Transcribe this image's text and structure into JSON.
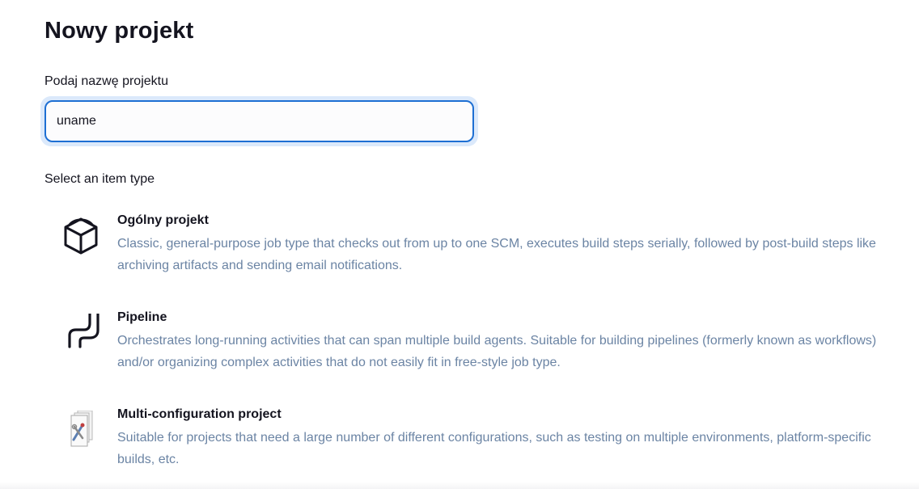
{
  "page": {
    "title": "Nowy projekt",
    "name_label": "Podaj nazwę projektu",
    "name_value": "uname",
    "section_label": "Select an item type"
  },
  "item_types": [
    {
      "name": "Ogólny projekt",
      "description": "Classic, general-purpose job type that checks out from up to one SCM, executes build steps serially, followed by post-build steps like archiving artifacts and sending email notifications.",
      "icon": "cube-icon"
    },
    {
      "name": "Pipeline",
      "description": "Orchestrates long-running activities that can span multiple build agents. Suitable for building pipelines (formerly known as workflows) and/or organizing complex activities that do not easily fit in free-style job type.",
      "icon": "pipeline-icon"
    },
    {
      "name": "Multi-configuration project",
      "description": "Suitable for projects that need a large number of different configurations, such as testing on multiple environments, platform-specific builds, etc.",
      "icon": "multi-config-icon"
    }
  ],
  "colors": {
    "accent": "#1d6fd3",
    "focus_ring": "#dbe9fb",
    "description_text": "#6b84a4"
  }
}
